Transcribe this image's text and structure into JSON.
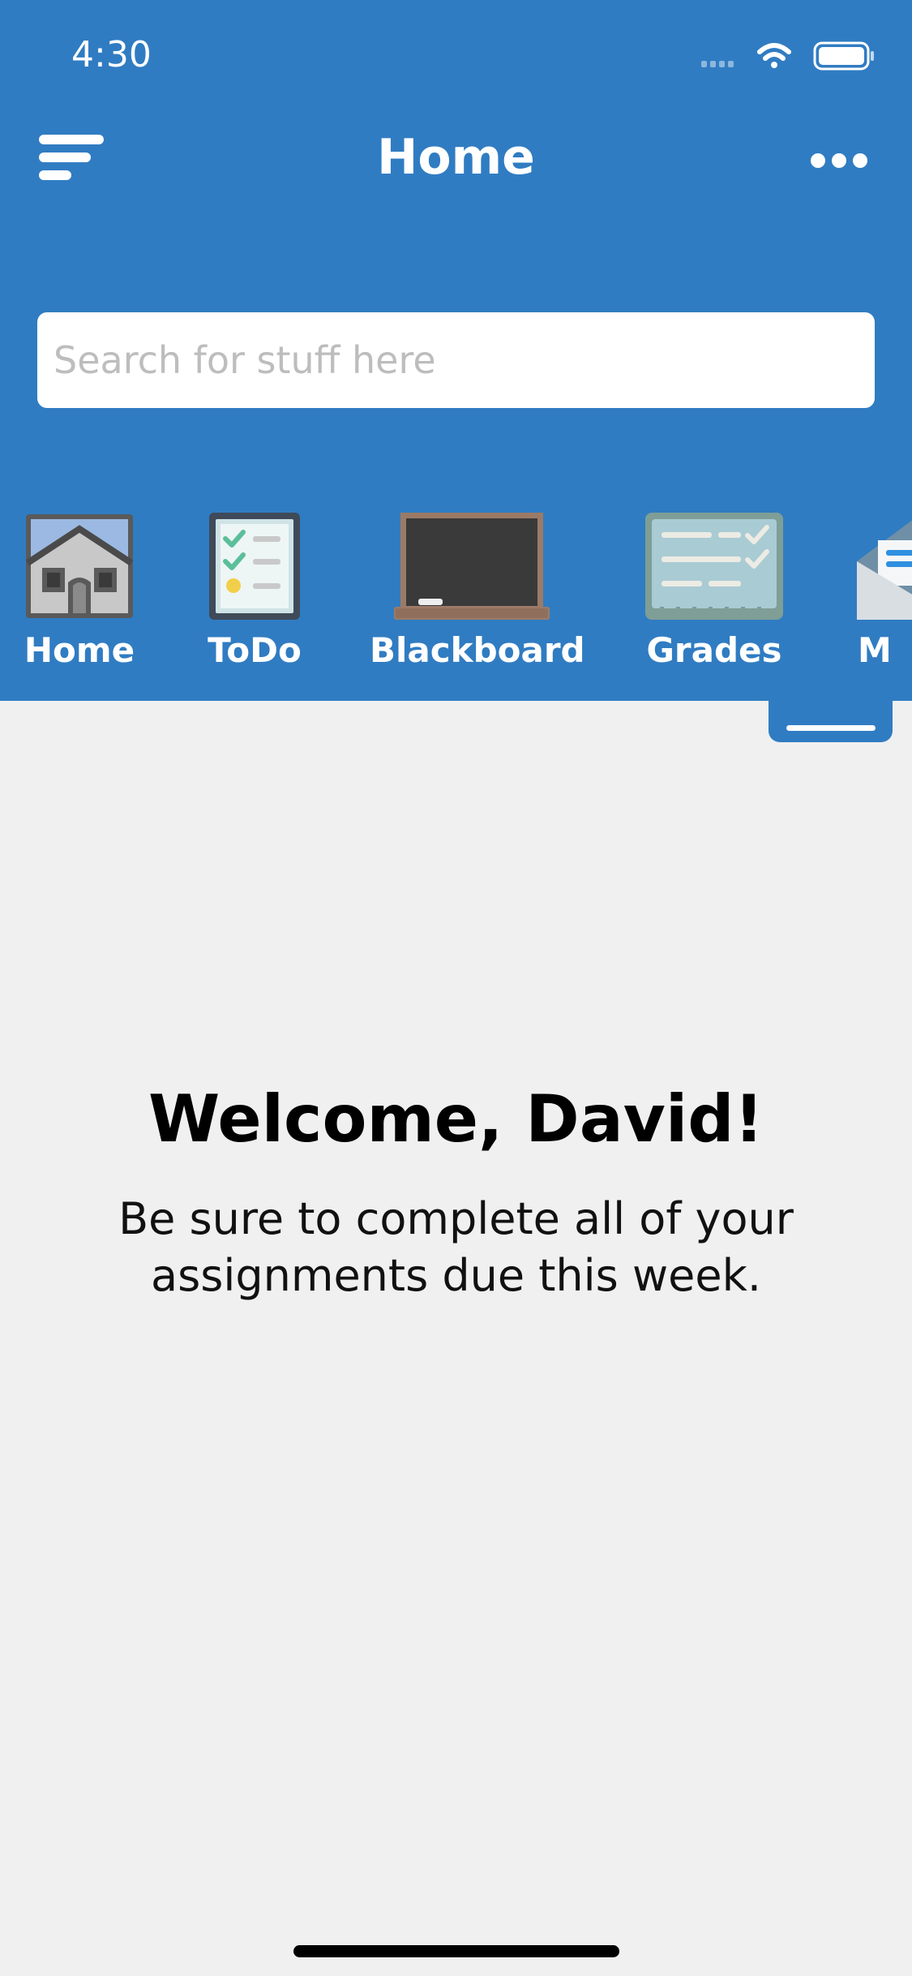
{
  "status_bar": {
    "time": "4:30",
    "icons": [
      "cellular-signal-icon",
      "wifi-icon",
      "battery-icon"
    ]
  },
  "header": {
    "title": "Home",
    "menu_icon": "menu-lines-icon",
    "more_icon": "more-dots-icon"
  },
  "search": {
    "placeholder": "Search for stuff here",
    "value": ""
  },
  "nav": {
    "items": [
      {
        "label": "Home",
        "icon": "house-icon"
      },
      {
        "label": "ToDo",
        "icon": "checklist-icon"
      },
      {
        "label": "Blackboard",
        "icon": "blackboard-icon"
      },
      {
        "label": "Grades",
        "icon": "grades-icon"
      },
      {
        "label": "M",
        "icon": "mail-icon"
      }
    ]
  },
  "main": {
    "welcome_title": "Welcome, David!",
    "welcome_message": "Be sure to complete all of your assignments due this week."
  },
  "colors": {
    "primary": "#307cc2",
    "background": "#f0f0f0",
    "text_dark": "#000000",
    "white": "#ffffff"
  }
}
